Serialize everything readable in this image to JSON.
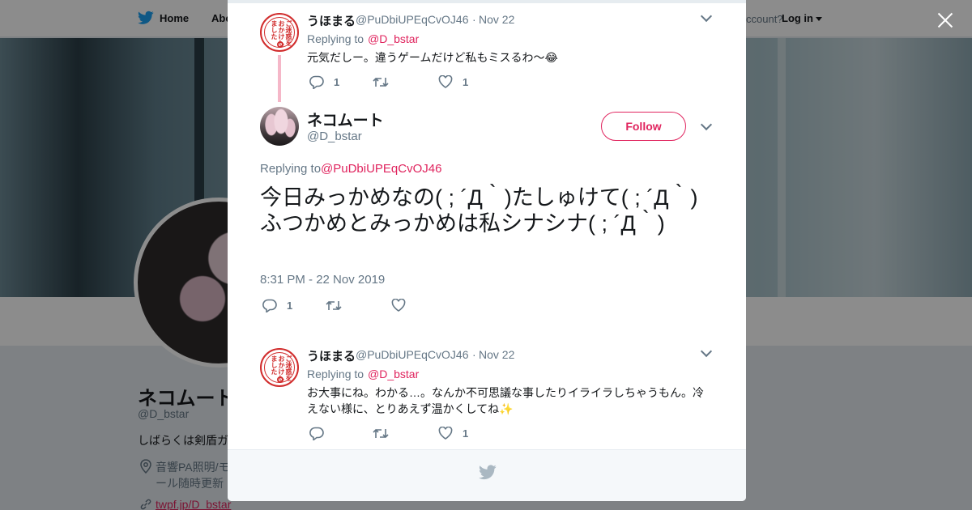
{
  "nav": {
    "home": "Home",
    "about": "Abo",
    "account_prompt": "ccount?",
    "login": "Log in"
  },
  "profile": {
    "name": "ネコムート",
    "handle": "@D_bstar",
    "bio": "しばらくは剣盾ガ",
    "location": "音響PA照明/モ ィール随時更新",
    "link": "twpf.jp/D_bstar"
  },
  "thread": [
    {
      "name": "うほまる",
      "handle": "@PuDbiUPEqCvOJ46",
      "dot": "·",
      "date": "Nov 22",
      "replying_prefix": "Replying to",
      "replying_to": "@D_bstar",
      "text": "元気だしー。違うゲームだけど私もミスるわ～😂",
      "reply_count": "1",
      "retweet_count": "",
      "like_count": "1"
    },
    {
      "name": "うほまる",
      "handle": "@PuDbiUPEqCvOJ46",
      "dot": "·",
      "date": "Nov 22",
      "replying_prefix": "Replying to",
      "replying_to": "@D_bstar",
      "text": "お大事にね。わかる…。なんか不可思議な事したりイライラしちゃうもん。冷えない様に、とりあえず温かくしてね✨",
      "reply_count": "",
      "retweet_count": "",
      "like_count": "1"
    }
  ],
  "main_tweet": {
    "name": "ネコムート",
    "handle": "@D_bstar",
    "follow_label": "Follow",
    "replying_prefix": "Replying to",
    "replying_to": "@PuDbiUPEqCvOJ46",
    "text": "今日みっかめなの( ; ´Д｀)たしゅけて( ; ´Д｀)ふつかめとみっかめは私シナシナ( ; ´Д｀)",
    "timestamp": "8:31 PM - 22 Nov 2019",
    "reply_count": "1",
    "retweet_count": "",
    "like_count": ""
  },
  "stamp_text": "ご迷惑をおかけしました",
  "colors": {
    "accent": "#e0245e",
    "thread_line": "#f5b7c8",
    "twitter_blue": "#1da1f2"
  }
}
